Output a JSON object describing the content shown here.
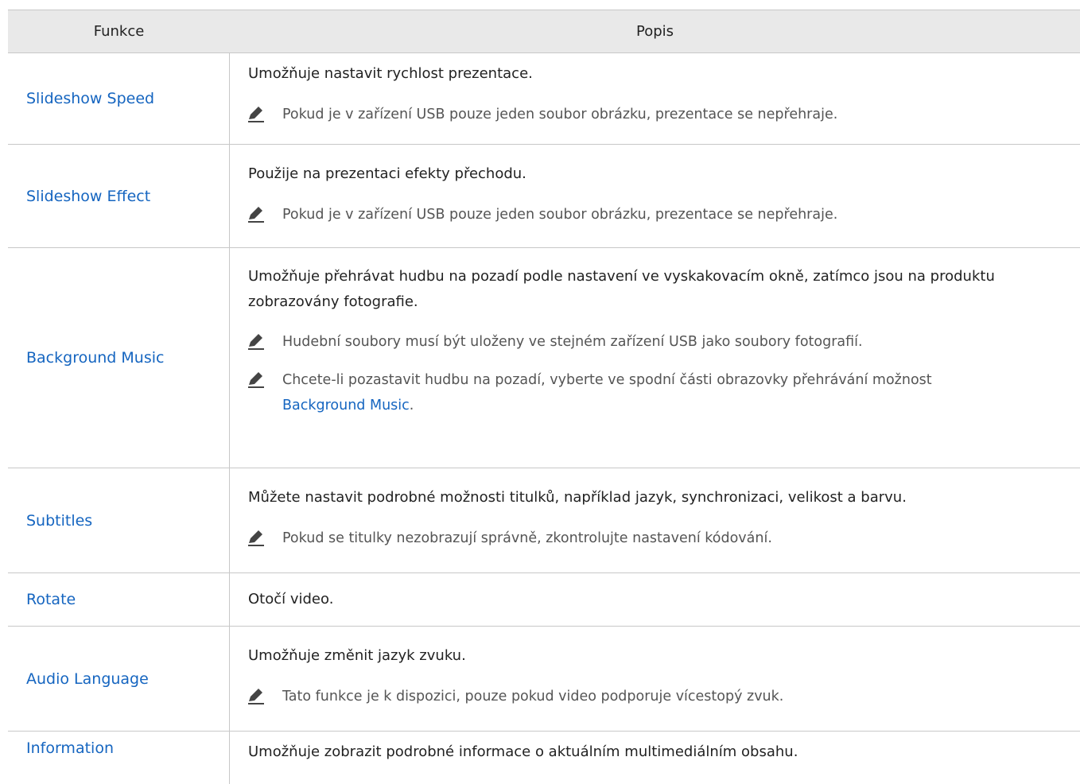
{
  "header": {
    "col1": "Funkce",
    "col2": "Popis"
  },
  "rows": [
    {
      "name": "Slideshow Speed",
      "desc": "Umožňuje nastavit rychlost prezentace.",
      "notes": [
        "Pokud je v zařízení USB pouze jeden soubor obrázku, prezentace se nepřehraje."
      ]
    },
    {
      "name": "Slideshow Effect",
      "desc": "Použije na prezentaci efekty přechodu.",
      "notes": [
        "Pokud je v zařízení USB pouze jeden soubor obrázku, prezentace se nepřehraje."
      ]
    },
    {
      "name": "Background Music",
      "desc": "Umožňuje přehrávat hudbu na pozadí podle nastavení ve vyskakovacím okně, zatímco jsou na produktu zobrazovány fotografie.",
      "notes": [
        "Hudební soubory musí být uloženy ve stejném zařízení USB jako soubory fotografií.",
        "Chcete-li pozastavit hudbu na pozadí, vyberte ve spodní části obrazovky přehrávání možnost"
      ],
      "note2_link": "Background Music",
      "note2_end": "."
    },
    {
      "name": "Subtitles",
      "desc": "Můžete nastavit podrobné možnosti titulků, například jazyk, synchronizaci, velikost a barvu.",
      "notes": [
        "Pokud se titulky nezobrazují správně, zkontrolujte nastavení kódování."
      ]
    },
    {
      "name": "Rotate",
      "desc": "Otočí video."
    },
    {
      "name": "Audio Language",
      "desc": "Umožňuje změnit jazyk zvuku.",
      "notes": [
        "Tato funkce je k dispozici, pouze pokud video podporuje vícestopý zvuk."
      ]
    },
    {
      "name": "Information",
      "desc": "Umožňuje zobrazit podrobné informace o aktuálním multimediálním obsahu."
    }
  ],
  "colors": {
    "link": "#1565c0",
    "header_bg": "#e9e9e9",
    "border": "#c8c8c8"
  },
  "icons": {
    "note": "pencil-note-icon"
  }
}
